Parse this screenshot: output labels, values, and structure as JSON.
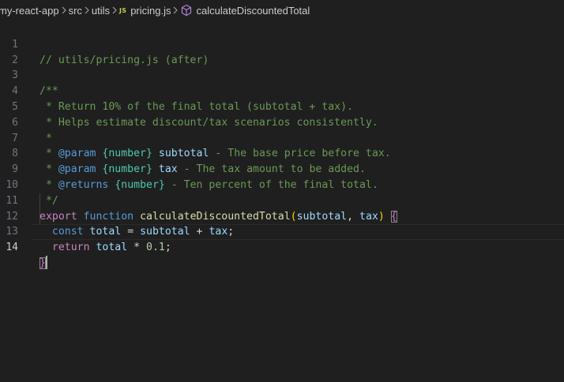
{
  "breadcrumb": {
    "segments": [
      "my-react-app",
      "src",
      "utils",
      "pricing.js",
      "calculateDiscountedTotal"
    ],
    "file_badge": "JS",
    "file_icon": "javascript-file-icon",
    "symbol_icon": "method-cube-icon"
  },
  "editor": {
    "current_line": 14,
    "line_numbers": [
      "1",
      "2",
      "3",
      "4",
      "5",
      "6",
      "7",
      "8",
      "9",
      "10",
      "11",
      "12",
      "13",
      "14"
    ],
    "tokens": {
      "l1": "// utils/pricing.js (after)",
      "l4_dstar": "/**",
      "l4": " * Return 10% of the final total (subtotal + tax).",
      "l5": " * Helps estimate discount/tax scenarios consistently.",
      "l6": " *",
      "star": " * ",
      "param": "@param",
      "returns": "@returns",
      "type_number": "{number}",
      "p_subtotal": "subtotal",
      "p_tax": "tax",
      "d7": " - The base price before tax.",
      "d8": " - The tax amount to be added.",
      "d9": " - Ten percent of the final total.",
      "l10": " */",
      "export": "export",
      "function": "function",
      "fn_name": "calculateDiscountedTotal",
      "open_paren": "(",
      "arg_subtotal": "subtotal",
      "comma": ", ",
      "arg_tax": "tax",
      "close_paren": ")",
      "open_brace": "{",
      "close_brace": "}",
      "const": "const",
      "v_total": "total",
      "eq": " = ",
      "plus": " + ",
      "semi": ";",
      "return": "return",
      "times": " * ",
      "num": "0.1"
    }
  },
  "colors": {
    "background": "#1f1f1f",
    "comment": "#6a9955",
    "keyword": "#c586c0",
    "storage": "#569cd6",
    "function": "#dcdcaa",
    "variable": "#9cdcfe",
    "type": "#4ec9b0",
    "number": "#b5cea8",
    "bracket": "#ffd700"
  }
}
